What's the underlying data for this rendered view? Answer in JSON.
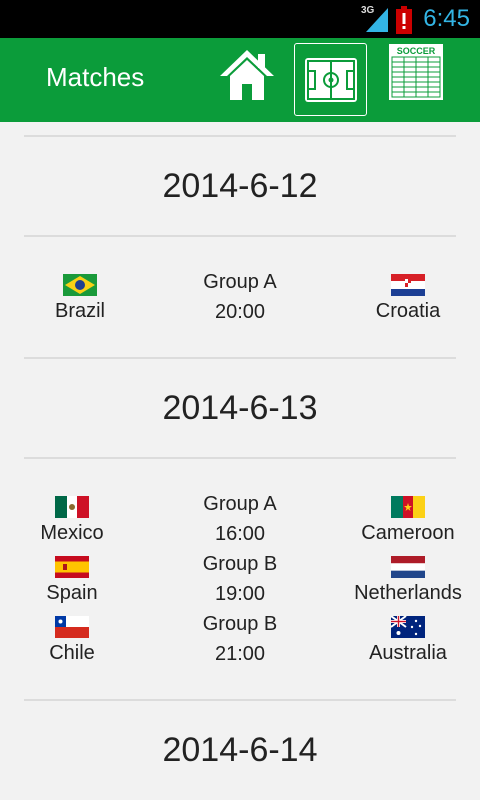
{
  "status_bar": {
    "network": "3G",
    "time": "6:45"
  },
  "app_bar": {
    "title": "Matches",
    "icons": [
      "home-icon",
      "soccer-field-icon",
      "soccer-table-icon"
    ],
    "table_icon_text": "SOCCER",
    "accent_color": "#0b9c3a"
  },
  "days": [
    {
      "date": "2014-6-12",
      "matches": [
        {
          "home": "Brazil",
          "group": "Group A",
          "time": "20:00",
          "away": "Croatia"
        }
      ]
    },
    {
      "date": "2014-6-13",
      "matches": [
        {
          "home": "Mexico",
          "group": "Group A",
          "time": "16:00",
          "away": "Cameroon"
        },
        {
          "home": "Spain",
          "group": "Group B",
          "time": "19:00",
          "away": "Netherlands"
        },
        {
          "home": "Chile",
          "group": "Group B",
          "time": "21:00",
          "away": "Australia"
        }
      ]
    },
    {
      "date": "2014-6-14",
      "matches": []
    }
  ]
}
